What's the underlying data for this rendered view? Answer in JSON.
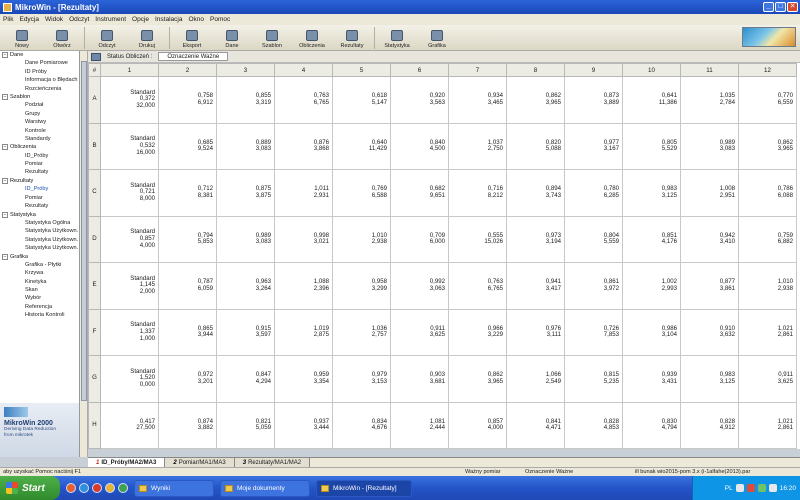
{
  "window": {
    "title": "MikroWin - [Rezultaty]"
  },
  "menu": [
    "Plik",
    "Edycja",
    "Widok",
    "Odczyt",
    "Instrument",
    "Opcje",
    "Instalacja",
    "Okno",
    "Pomoc"
  ],
  "toolbar": [
    "Nowy",
    "Otwórz",
    "Odczyt",
    "Drukuj",
    "Eksport",
    "Dane",
    "Szablon",
    "Obliczenia",
    "Rezultaty",
    "Statystyka",
    "Grafika"
  ],
  "status_row": {
    "label": "Status Obliczeń :",
    "value": "Oznaczenie Ważne"
  },
  "sidebar": [
    {
      "group": "Dane",
      "items": [
        "Dane Pomiarowe",
        "ID Próby",
        "Informacja o Błędach",
        "Rozcieńczenia"
      ]
    },
    {
      "group": "Szablon",
      "items": [
        "Podział",
        "Grupy",
        "Warstwy",
        "Kontrole",
        "Standardy"
      ]
    },
    {
      "group": "Obliczenia",
      "items": [
        "ID_Próby",
        "Pomiar",
        "Rezultaty"
      ]
    },
    {
      "group": "Rezultaty",
      "items": [
        "ID_Próby",
        "Pomiar",
        "Rezultaty"
      ]
    },
    {
      "group": "Statystyka",
      "items": [
        "Statystyka Ogólna",
        "Statystyka Użytkown.",
        "Statystyka Użytkown.",
        "Statystyka Użytkown."
      ]
    },
    {
      "group": "Grafika",
      "items": [
        "Grafika - Płytki",
        "Krzywa",
        "Kinetyka",
        "Skan",
        "Wybór",
        "Referencja",
        "Historia Kontroli"
      ]
    }
  ],
  "brand": {
    "name": "MikroWin 2000",
    "tagline_1": "Deriving Data Reduction",
    "tagline_2": "from mikrotek"
  },
  "grid": {
    "corner": "#",
    "columns": [
      "1",
      "2",
      "3",
      "4",
      "5",
      "6",
      "7",
      "8",
      "9",
      "10",
      "11",
      "12"
    ],
    "rows": [
      {
        "label": "A",
        "cells": [
          [
            "Standard",
            "0,372",
            "32,000"
          ],
          [
            "0,758",
            "6,912"
          ],
          [
            "0,855",
            "3,319"
          ],
          [
            "0,763",
            "6,765"
          ],
          [
            "0,618",
            "5,147"
          ],
          [
            "0,920",
            "3,563"
          ],
          [
            "0,934",
            "3,465"
          ],
          [
            "0,862",
            "3,965"
          ],
          [
            "0,873",
            "3,889"
          ],
          [
            "0,641",
            "11,386"
          ],
          [
            "1,035",
            "2,784"
          ],
          [
            "0,770",
            "6,559"
          ]
        ]
      },
      {
        "label": "B",
        "cells": [
          [
            "Standard",
            "0,532",
            "16,000"
          ],
          [
            "0,685",
            "9,524"
          ],
          [
            "0,889",
            "3,083"
          ],
          [
            "0,876",
            "3,868"
          ],
          [
            "0,640",
            "11,429"
          ],
          [
            "0,840",
            "4,500"
          ],
          [
            "1,037",
            "2,750"
          ],
          [
            "0,820",
            "5,088"
          ],
          [
            "0,977",
            "3,167"
          ],
          [
            "0,805",
            "5,529"
          ],
          [
            "0,989",
            "3,083"
          ],
          [
            "0,862",
            "3,965"
          ]
        ]
      },
      {
        "label": "C",
        "cells": [
          [
            "Standard",
            "0,721",
            "8,000"
          ],
          [
            "0,712",
            "8,381"
          ],
          [
            "0,875",
            "3,875"
          ],
          [
            "1,011",
            "2,931"
          ],
          [
            "0,769",
            "6,588"
          ],
          [
            "0,682",
            "9,651"
          ],
          [
            "0,716",
            "8,212"
          ],
          [
            "0,894",
            "3,743"
          ],
          [
            "0,780",
            "6,285"
          ],
          [
            "0,983",
            "3,125"
          ],
          [
            "1,008",
            "2,951"
          ],
          [
            "0,786",
            "6,088"
          ]
        ]
      },
      {
        "label": "D",
        "cells": [
          [
            "Standard",
            "0,857",
            "4,000"
          ],
          [
            "0,794",
            "5,853"
          ],
          [
            "0,989",
            "3,083"
          ],
          [
            "0,998",
            "3,021"
          ],
          [
            "1,010",
            "2,938"
          ],
          [
            "0,709",
            "6,000"
          ],
          [
            "0,555",
            "15,026"
          ],
          [
            "0,973",
            "3,194"
          ],
          [
            "0,804",
            "5,559"
          ],
          [
            "0,851",
            "4,176"
          ],
          [
            "0,942",
            "3,410"
          ],
          [
            "0,759",
            "6,882"
          ]
        ]
      },
      {
        "label": "E",
        "cells": [
          [
            "Standard",
            "1,145",
            "2,000"
          ],
          [
            "0,787",
            "6,059"
          ],
          [
            "0,963",
            "3,264"
          ],
          [
            "1,088",
            "2,396"
          ],
          [
            "0,958",
            "3,299"
          ],
          [
            "0,992",
            "3,063"
          ],
          [
            "0,763",
            "6,765"
          ],
          [
            "0,941",
            "3,417"
          ],
          [
            "0,861",
            "3,972"
          ],
          [
            "1,002",
            "2,993"
          ],
          [
            "0,877",
            "3,861"
          ],
          [
            "1,010",
            "2,938"
          ]
        ]
      },
      {
        "label": "F",
        "cells": [
          [
            "Standard",
            "1,337",
            "1,000"
          ],
          [
            "0,865",
            "3,944"
          ],
          [
            "0,915",
            "3,597"
          ],
          [
            "1,019",
            "2,875"
          ],
          [
            "1,036",
            "2,757"
          ],
          [
            "0,911",
            "3,625"
          ],
          [
            "0,966",
            "3,229"
          ],
          [
            "0,976",
            "3,111"
          ],
          [
            "0,726",
            "7,853"
          ],
          [
            "0,986",
            "3,104"
          ],
          [
            "0,910",
            "3,632"
          ],
          [
            "1,021",
            "2,861"
          ]
        ]
      },
      {
        "label": "G",
        "cells": [
          [
            "Standard",
            "1,520",
            "0,000"
          ],
          [
            "0,972",
            "3,201"
          ],
          [
            "0,847",
            "4,294"
          ],
          [
            "0,959",
            "3,354"
          ],
          [
            "0,979",
            "3,153"
          ],
          [
            "0,903",
            "3,681"
          ],
          [
            "0,862",
            "3,965"
          ],
          [
            "1,066",
            "2,549"
          ],
          [
            "0,815",
            "5,235"
          ],
          [
            "0,939",
            "3,431"
          ],
          [
            "0,983",
            "3,125"
          ],
          [
            "0,911",
            "3,625"
          ]
        ]
      },
      {
        "label": "H",
        "cells": [
          [
            "0,417",
            "27,500"
          ],
          [
            "0,874",
            "3,882"
          ],
          [
            "0,821",
            "5,059"
          ],
          [
            "0,937",
            "3,444"
          ],
          [
            "0,834",
            "4,676"
          ],
          [
            "1,081",
            "2,444"
          ],
          [
            "0,857",
            "4,000"
          ],
          [
            "0,841",
            "4,471"
          ],
          [
            "0,828",
            "4,853"
          ],
          [
            "0,830",
            "4,794"
          ],
          [
            "0,828",
            "4,912"
          ],
          [
            "1,021",
            "2,861"
          ]
        ]
      }
    ]
  },
  "tabs": [
    {
      "num": "1",
      "label": "ID_Próby/MA2/MA3"
    },
    {
      "num": "2",
      "label": "Pomiar/MA1/MA3"
    },
    {
      "num": "3",
      "label": "Rezultaty/MA1/MA2"
    }
  ],
  "app_status": {
    "hint": "aby uzyskać Pomoc naciśnij F1",
    "measure": "Ważny pomiar",
    "mark": "Oznaczenie Ważne",
    "file": "ill bunak wio2015-pom 3.x (i-1alfahe(2013).par"
  },
  "taskbar": {
    "start": "Start",
    "items": [
      "Wyniki",
      "Moje dokumenty",
      "MikroWin - [Rezultaty]"
    ],
    "clock": "16:20",
    "lang": "PL"
  },
  "colors": {
    "titlebar": "#2c64d8",
    "taskbar": "#2454c8",
    "start": "#3f9a3a",
    "active_tab_num": "#c42a1d"
  }
}
